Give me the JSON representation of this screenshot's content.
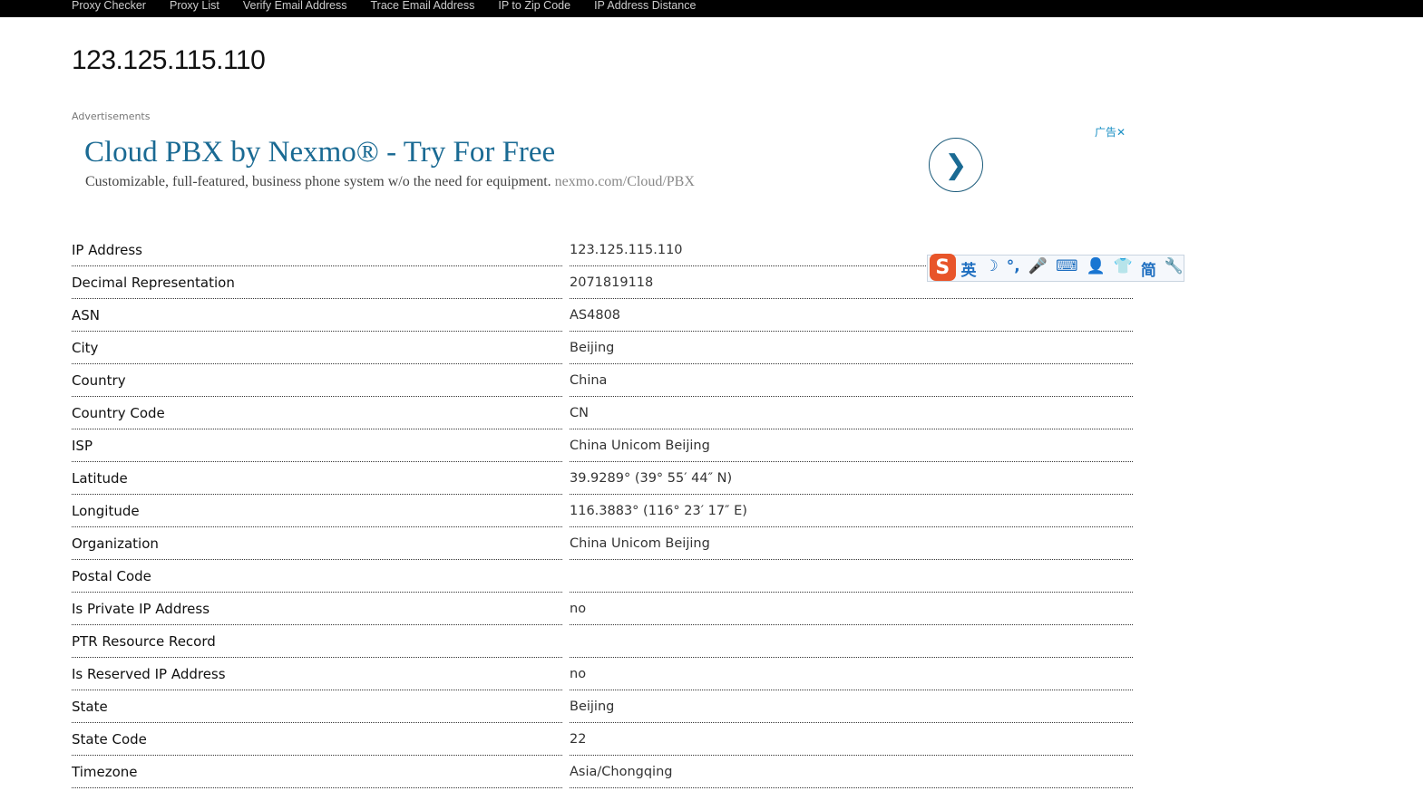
{
  "nav": [
    "Proxy Checker",
    "Proxy List",
    "Verify Email Address",
    "Trace Email Address",
    "IP to Zip Code",
    "IP Address Distance"
  ],
  "title": "123.125.115.110",
  "ad": {
    "label": "Advertisements",
    "title": "Cloud PBX by Nexmo® - Try For Free",
    "desc": "Customizable, full-featured, business phone system w/o the need for equipment.",
    "url": "nexmo.com/Cloud/PBX",
    "close": "广告✕"
  },
  "rows": [
    {
      "k": "IP Address",
      "v": "123.125.115.110"
    },
    {
      "k": "Decimal Representation",
      "v": "2071819118"
    },
    {
      "k": "ASN",
      "v": "AS4808"
    },
    {
      "k": "City",
      "v": "Beijing"
    },
    {
      "k": "Country",
      "v": "China"
    },
    {
      "k": "Country Code",
      "v": "CN"
    },
    {
      "k": "ISP",
      "v": "China Unicom Beijing"
    },
    {
      "k": "Latitude",
      "v": "39.9289° (39° 55′ 44″ N)"
    },
    {
      "k": "Longitude",
      "v": "116.3883° (116° 23′ 17″ E)"
    },
    {
      "k": "Organization",
      "v": "China Unicom Beijing"
    },
    {
      "k": "Postal Code",
      "v": ""
    },
    {
      "k": "Is Private IP Address",
      "v": "no"
    },
    {
      "k": "PTR Resource Record",
      "v": ""
    },
    {
      "k": "Is Reserved IP Address",
      "v": "no"
    },
    {
      "k": "State",
      "v": "Beijing"
    },
    {
      "k": "State Code",
      "v": "22"
    },
    {
      "k": "Timezone",
      "v": "Asia/Chongqing"
    }
  ],
  "ime": {
    "logo": "S",
    "items": [
      "英",
      "☽",
      "°,",
      "🎤",
      "⌨",
      "👤",
      "👕",
      "简",
      "🔧"
    ]
  }
}
